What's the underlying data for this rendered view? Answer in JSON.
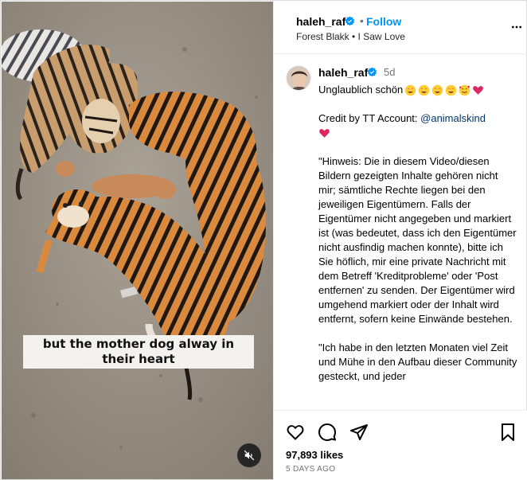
{
  "media": {
    "caption": "but the mother dog alway in their heart",
    "mute_icon": "speaker-muted-icon"
  },
  "header": {
    "username": "haleh_raf",
    "separator": "•",
    "follow_label": "Follow",
    "audio": "Forest Blakk • I Saw Love",
    "verified_color": "#0095f6"
  },
  "comment": {
    "username": "haleh_raf",
    "time": "5d",
    "line1": "Unglaublich schön",
    "credit_prefix": "Credit by TT Account: ",
    "credit_mention": "@animalskind",
    "paragraph1": "\"Hinweis: Die in diesem Video/diesen Bildern gezeigten Inhalte gehören nicht mir; sämtliche Rechte liegen bei den jeweiligen Eigentümern. Falls der Eigentümer nicht angegeben und markiert ist (was bedeutet, dass ich den Eigentümer nicht ausfindig machen konnte), bitte ich Sie höflich, mir eine private Nachricht mit dem Betreff 'Kreditprobleme' oder 'Post entfernen' zu senden. Der Eigentümer wird umgehend markiert oder der Inhalt wird entfernt, sofern keine Einwände bestehen.",
    "paragraph2": "\"Ich habe in den letzten Monaten viel Zeit und Mühe in den Aufbau dieser Community gesteckt, und jeder"
  },
  "actions": {
    "likes": "97,893 likes",
    "ago": "5 DAYS AGO"
  },
  "colors": {
    "link": "#00376b",
    "accent": "#0095f6",
    "muted": "#737373"
  }
}
